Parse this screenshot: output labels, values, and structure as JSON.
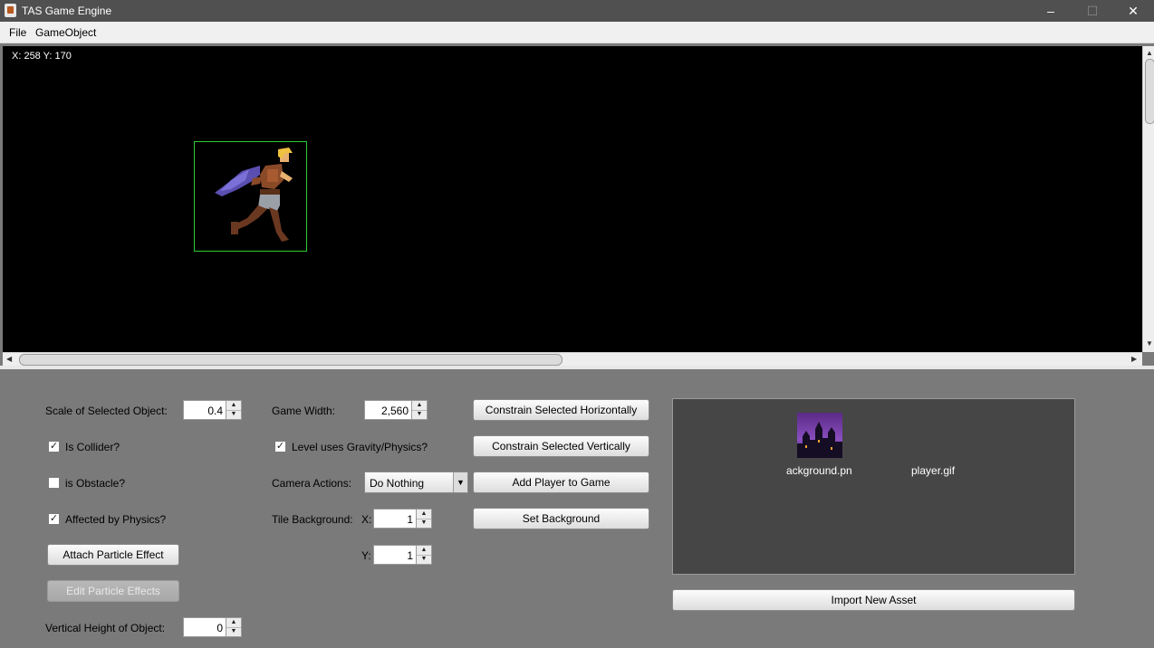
{
  "window": {
    "title": "TAS Game Engine",
    "minimize_glyph": "–",
    "maximize_glyph": "☐",
    "close_glyph": "✕"
  },
  "menubar": {
    "items": [
      {
        "label": "File"
      },
      {
        "label": "GameObject"
      }
    ]
  },
  "viewport": {
    "coords_text": "X: 258 Y: 170",
    "background_color": "#000000",
    "selection_color": "#2ecc2e"
  },
  "object_props": {
    "scale_label": "Scale of Selected Object:",
    "scale_value": "0.4",
    "is_collider_label": "Is Collider?",
    "is_collider_checked": true,
    "is_obstacle_label": "is Obstacle?",
    "is_obstacle_checked": false,
    "affected_by_physics_label": "Affected by Physics?",
    "affected_by_physics_checked": true,
    "attach_particle_label": "Attach Particle Effect",
    "edit_particle_label": "Edit Particle Effects",
    "vertical_height_label": "Vertical Height of Object:",
    "vertical_height_value": "0"
  },
  "game_props": {
    "game_width_label": "Game Width:",
    "game_width_value": "2,560",
    "gravity_label": "Level uses Gravity/Physics?",
    "gravity_checked": true,
    "camera_label": "Camera Actions:",
    "camera_value": "Do Nothing",
    "tile_label": "Tile Background:",
    "tile_x_label": "X:",
    "tile_x_value": "1",
    "tile_y_label": "Y:",
    "tile_y_value": "1"
  },
  "actions": {
    "constrain_h": "Constrain Selected Horizontally",
    "constrain_v": "Constrain Selected Vertically",
    "add_player": "Add Player to Game",
    "set_background": "Set Background"
  },
  "assets": {
    "items": [
      {
        "name": "ackground.pn"
      },
      {
        "name": "player.gif"
      }
    ],
    "import_label": "Import New Asset"
  },
  "glyphs": {
    "check": "✓",
    "spin_up": "▲",
    "spin_down": "▼",
    "combo_arrow": "▼",
    "scroll_up": "▲",
    "scroll_down": "▼",
    "scroll_left": "◀",
    "scroll_right": "▶"
  }
}
